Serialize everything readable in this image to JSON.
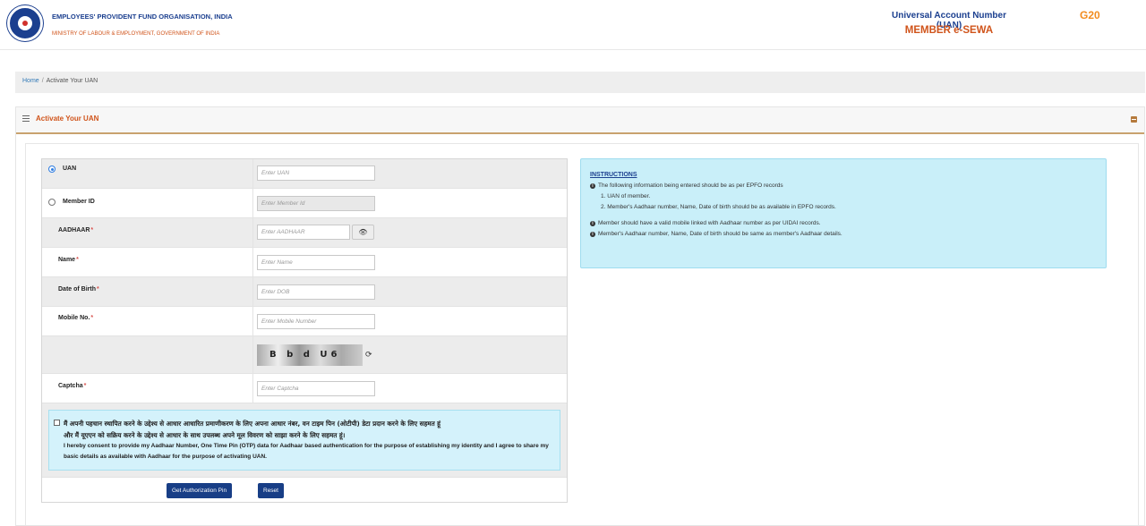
{
  "header": {
    "org_name": "EMPLOYEES' PROVIDENT FUND ORGANISATION, INDIA",
    "ministry": "MINISTRY OF LABOUR & EMPLOYMENT, GOVERNMENT OF INDIA",
    "uan_title": "Universal Account Number (UAN)",
    "portal_title": "MEMBER e-SEWA",
    "g20_text": "G20"
  },
  "breadcrumb": {
    "home": "Home",
    "separator": "/",
    "current": "Activate Your UAN"
  },
  "panel": {
    "title": "Activate Your UAN"
  },
  "form": {
    "uan": {
      "label": "UAN",
      "placeholder": "Enter UAN",
      "selected": true
    },
    "member_id": {
      "label": "Member ID",
      "placeholder": "Enter Member Id",
      "selected": false
    },
    "aadhaar": {
      "label": "AADHAAR",
      "star": "*",
      "placeholder": "Enter AADHAAR"
    },
    "name": {
      "label": "Name",
      "star": "*",
      "placeholder": "Enter Name"
    },
    "dob": {
      "label": "Date of Birth",
      "star": "*",
      "placeholder": "Enter DOB"
    },
    "mobile": {
      "label": "Mobile No.",
      "star": "*",
      "placeholder": "Enter Mobile Number"
    },
    "captcha_text": "B b d U6",
    "captcha": {
      "label": "Captcha",
      "star": "*",
      "placeholder": "Enter Captcha"
    },
    "consent_hindi_1": "मैं अपनी पहचान स्थापित करने के उद्देश्य से आधार आधारित प्रमाणीकरण के लिए अपना आधार नंबर, वन टाइम पिन (ओटीपी) डेटा प्रदान करने के लिए सहमत हूं",
    "consent_hindi_2": "और मैं यूएएन को सक्रिय करने के उद्देश्य से आधार के साथ उपलब्ध अपने मूल विवरण को साझा करने के लिए सहमत हूं।",
    "consent_english": "I hereby consent to provide my Aadhaar Number, One Time Pin (OTP) data for Aadhaar based authentication for the purpose of establishing my identity and I agree to share my basic details as available with Aadhaar for the purpose of activating UAN.",
    "get_pin_label": "Get Authorization Pin",
    "reset_label": "Reset"
  },
  "instructions": {
    "title": "INSTRUCTIONS",
    "line1": "The following information being entered should be as per EPFO records",
    "sub1": "1. UAN of member.",
    "sub2": "2. Member's Aadhaar number, Name, Date of birth should be as available in EPFO records.",
    "line2": "Member should have a valid mobile linked with Aadhaar number as per UIDAI records.",
    "line3": "Member's Aadhaar number, Name, Date of birth should be same as member's Aadhaar details."
  },
  "colors": {
    "brand_blue": "#1b3f8f",
    "brand_orange": "#d0541b",
    "button_blue": "#183e86",
    "info_bg": "#c9eff9"
  }
}
